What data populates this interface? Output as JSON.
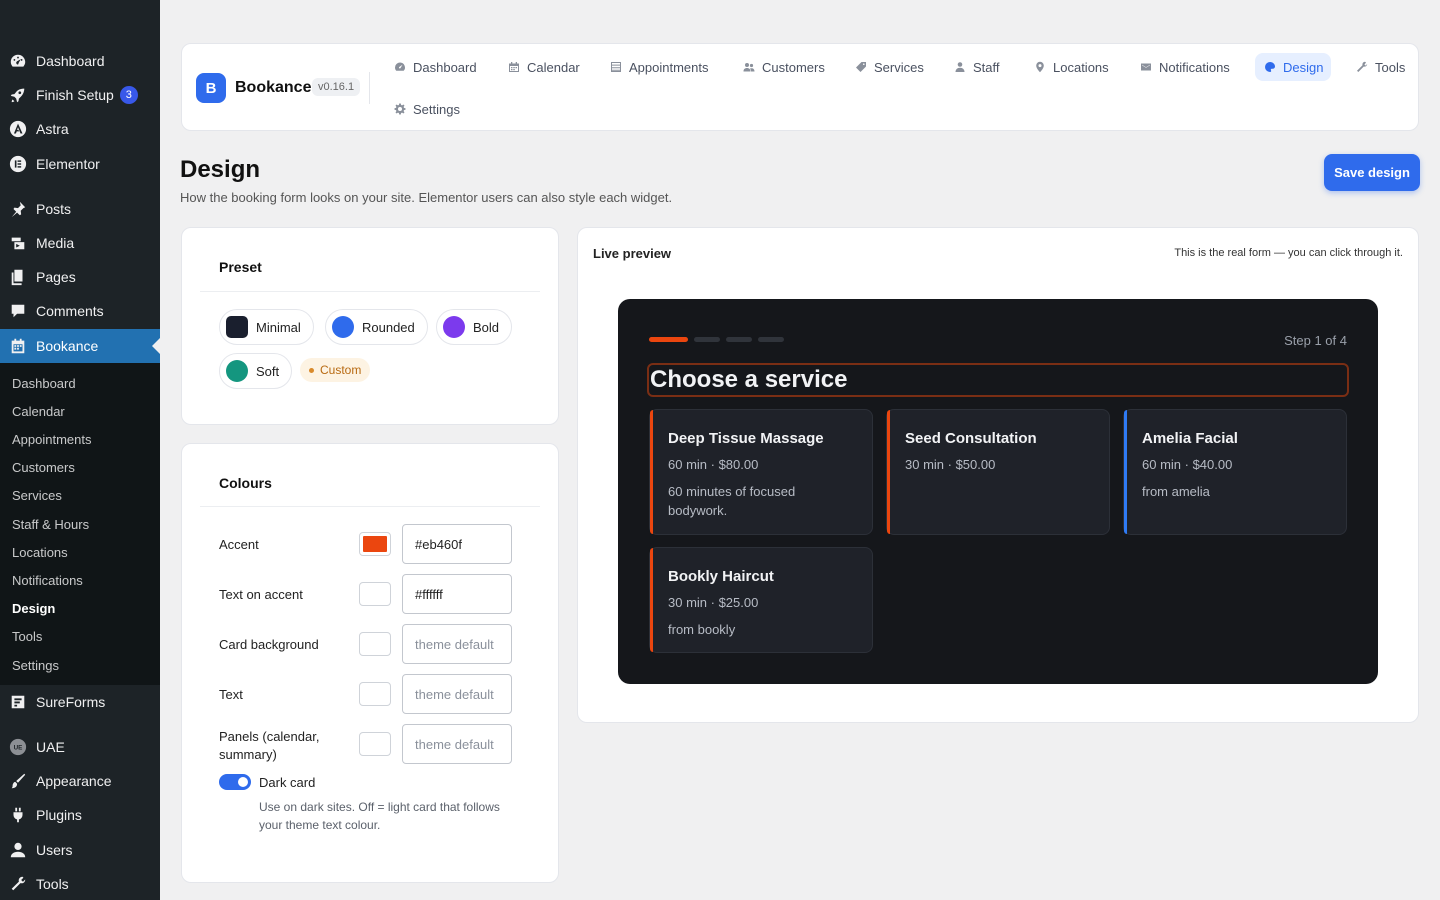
{
  "wp_menu": {
    "items": [
      {
        "label": "Dashboard",
        "icon": "dashboard-icon"
      },
      {
        "label": "Finish Setup",
        "icon": "rocket-icon",
        "badge": "3"
      },
      {
        "label": "Astra",
        "icon": "astra-icon"
      },
      {
        "label": "Elementor",
        "icon": "elementor-icon"
      },
      {
        "label": "Posts",
        "icon": "pin-icon"
      },
      {
        "label": "Media",
        "icon": "media-icon"
      },
      {
        "label": "Pages",
        "icon": "pages-icon"
      },
      {
        "label": "Comments",
        "icon": "comments-icon"
      },
      {
        "label": "Bookance",
        "icon": "calendar-icon"
      },
      {
        "label": "SureForms",
        "icon": "sureforms-icon"
      },
      {
        "label": "UAE",
        "icon": "uae-icon"
      },
      {
        "label": "Appearance",
        "icon": "brush-icon"
      },
      {
        "label": "Plugins",
        "icon": "plug-icon"
      },
      {
        "label": "Users",
        "icon": "user-icon"
      },
      {
        "label": "Tools",
        "icon": "wrench-icon"
      }
    ],
    "submenu": [
      "Dashboard",
      "Calendar",
      "Appointments",
      "Customers",
      "Services",
      "Staff & Hours",
      "Locations",
      "Notifications",
      "Design",
      "Tools",
      "Settings"
    ]
  },
  "app": {
    "logo_letter": "B",
    "name": "Bookance",
    "version": "v0.16.1",
    "nav": [
      {
        "label": "Dashboard",
        "icon": "gauge-icon"
      },
      {
        "label": "Calendar",
        "icon": "calendar-icon"
      },
      {
        "label": "Appointments",
        "icon": "list-icon"
      },
      {
        "label": "Customers",
        "icon": "users-icon"
      },
      {
        "label": "Services",
        "icon": "tag-icon"
      },
      {
        "label": "Staff",
        "icon": "person-icon"
      },
      {
        "label": "Locations",
        "icon": "map-pin-icon"
      },
      {
        "label": "Notifications",
        "icon": "envelope-icon"
      },
      {
        "label": "Design",
        "icon": "palette-icon",
        "active": true
      },
      {
        "label": "Tools",
        "icon": "wrench-icon"
      },
      {
        "label": "Settings",
        "icon": "gear-icon"
      }
    ]
  },
  "page": {
    "title": "Design",
    "subtitle": "How the booking form looks on your site. Elementor users can also style each widget.",
    "save_label": "Save design"
  },
  "preset": {
    "title": "Preset",
    "options": [
      {
        "label": "Minimal",
        "color": "#1a1f2e"
      },
      {
        "label": "Rounded",
        "color": "#2f6bec"
      },
      {
        "label": "Bold",
        "color": "#7c3aed"
      },
      {
        "label": "Soft",
        "color": "#14967f"
      }
    ],
    "custom_label": "Custom"
  },
  "colours": {
    "title": "Colours",
    "rows": [
      {
        "label": "Accent",
        "value": "#eb460f",
        "placeholder": "",
        "swatch": "#eb460f"
      },
      {
        "label": "Text on accent",
        "value": "#ffffff",
        "placeholder": "",
        "swatch": "#ffffff"
      },
      {
        "label": "Card background",
        "value": "",
        "placeholder": "theme default",
        "swatch": "#ffffff"
      },
      {
        "label": "Text",
        "value": "",
        "placeholder": "theme default",
        "swatch": "#ffffff"
      },
      {
        "label": "Panels (calendar, summary)",
        "value": "",
        "placeholder": "theme default",
        "swatch": "#ffffff"
      }
    ],
    "dark_card": {
      "label": "Dark card",
      "on": true,
      "help": "Use on dark sites. Off = light card that follows your theme text colour."
    }
  },
  "preview": {
    "title": "Live preview",
    "note": "This is the real form — you can click through it.",
    "step_text": "Step 1 of 4",
    "steps": 4,
    "current_step": 1,
    "heading": "Choose a service",
    "accent": "#eb460f",
    "services": [
      {
        "name": "Deep Tissue Massage",
        "meta": "60 min · $80.00",
        "desc": "60 minutes of focused bodywork.",
        "accent": "#eb460f"
      },
      {
        "name": "Seed Consultation",
        "meta": "30 min · $50.00",
        "desc": "",
        "accent": "#eb460f"
      },
      {
        "name": "Amelia Facial",
        "meta": "60 min · $40.00",
        "desc": "from amelia",
        "accent": "#2f7bf5"
      },
      {
        "name": "Bookly Haircut",
        "meta": "30 min · $25.00",
        "desc": "from bookly",
        "accent": "#eb460f"
      }
    ]
  }
}
